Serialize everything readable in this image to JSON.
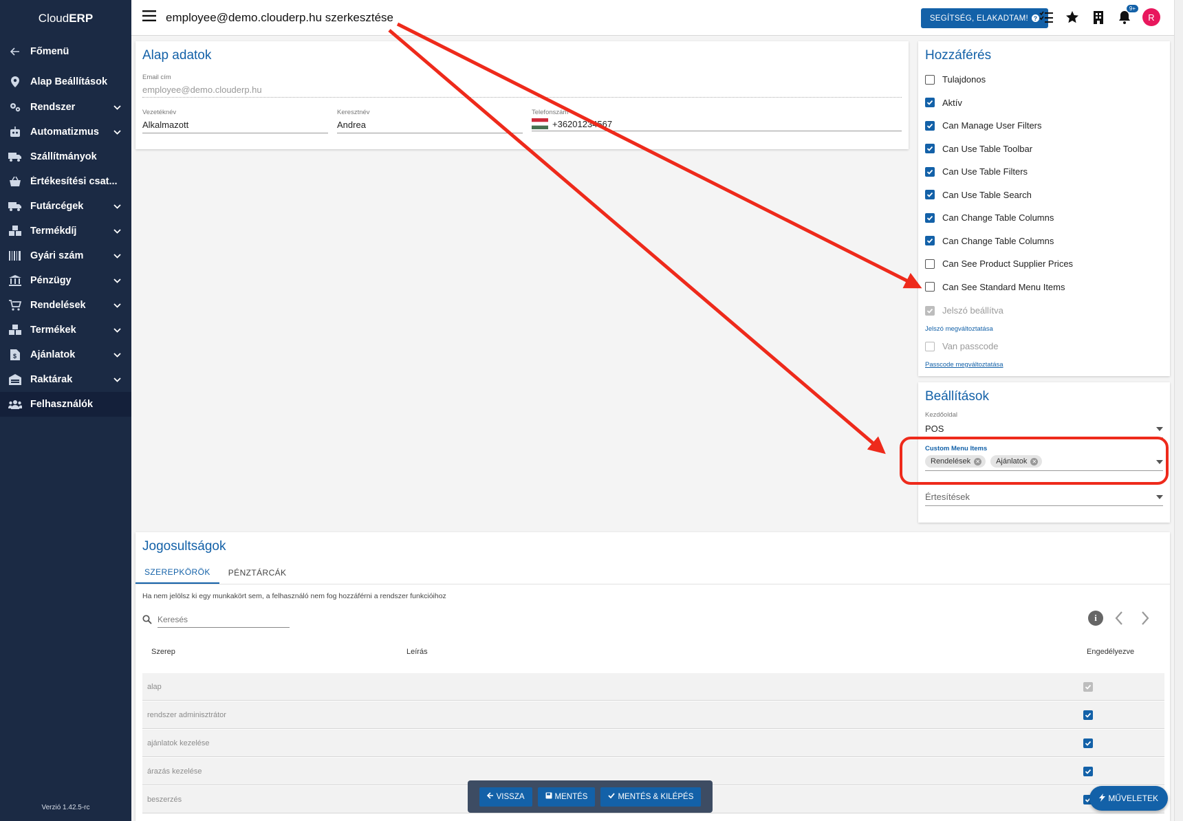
{
  "app": {
    "brand_light": "Cloud",
    "brand_bold": "ERP",
    "version": "Verzió 1.42.5-rc"
  },
  "sidebar": {
    "back_label": "Főmenü",
    "items": [
      {
        "label": "Alap Beállítások",
        "icon": "pin-icon",
        "chevron": false
      },
      {
        "label": "Rendszer",
        "icon": "cogs-icon",
        "chevron": true
      },
      {
        "label": "Automatizmus",
        "icon": "robot-icon",
        "chevron": true
      },
      {
        "label": "Szállítmányok",
        "icon": "truck-icon",
        "chevron": false
      },
      {
        "label": "Értékesítési csat...",
        "icon": "basket-icon",
        "chevron": false
      },
      {
        "label": "Futárcégek",
        "icon": "truck-icon",
        "chevron": true
      },
      {
        "label": "Termékdíj",
        "icon": "boxes-icon",
        "chevron": true
      },
      {
        "label": "Gyári szám",
        "icon": "barcode-icon",
        "chevron": true
      },
      {
        "label": "Pénzügy",
        "icon": "bank-icon",
        "chevron": true
      },
      {
        "label": "Rendelések",
        "icon": "cart-icon",
        "chevron": true
      },
      {
        "label": "Termékek",
        "icon": "boxes-icon",
        "chevron": true
      },
      {
        "label": "Ajánlatok",
        "icon": "file-dollar-icon",
        "chevron": true
      },
      {
        "label": "Raktárak",
        "icon": "warehouse-icon",
        "chevron": true
      },
      {
        "label": "Felhasználók",
        "icon": "users-icon",
        "chevron": false
      }
    ]
  },
  "header": {
    "title": "employee@demo.clouderp.hu szerkesztése",
    "help_label": "SEGÍTSÉG, ELAKADTAM!",
    "notif_badge": "9+",
    "avatar_letter": "R"
  },
  "basic": {
    "title": "Alap adatok",
    "email_label": "Email cím",
    "email_value": "employee@demo.clouderp.hu",
    "lastname_label": "Vezetéknév",
    "lastname_value": "Alkalmazott",
    "firstname_label": "Keresztnév",
    "firstname_value": "Andrea",
    "phone_label": "Telefonszám",
    "phone_value": "+36201234567"
  },
  "access": {
    "title": "Hozzáférés",
    "items": [
      {
        "label": "Tulajdonos",
        "checked": false
      },
      {
        "label": "Aktív",
        "checked": true
      },
      {
        "label": "Can Manage User Filters",
        "checked": true
      },
      {
        "label": "Can Use Table Toolbar",
        "checked": true
      },
      {
        "label": "Can Use Table Filters",
        "checked": true
      },
      {
        "label": "Can Use Table Search",
        "checked": true
      },
      {
        "label": "Can Change Table Columns",
        "checked": true
      },
      {
        "label": "Can Change Table Columns",
        "checked": true
      },
      {
        "label": "Can See Product Supplier Prices",
        "checked": false
      },
      {
        "label": "Can See Standard Menu Items",
        "checked": false
      }
    ],
    "password_set_label": "Jelszó beállítva",
    "password_change_link": "Jelszó megváltoztatása",
    "passcode_label": "Van passcode",
    "passcode_change_link": "Passcode megváltoztatása"
  },
  "settings": {
    "title": "Beállítások",
    "home_label": "Kezdőoldal",
    "home_value": "POS",
    "custom_menu_label": "Custom Menu Items",
    "custom_menu_chips": [
      "Rendelések",
      "Ajánlatok"
    ],
    "notifications_placeholder": "Értesítések"
  },
  "permissions": {
    "title": "Jogosultságok",
    "tabs": [
      "SZEREPKÖRÖK",
      "PÉNZTÁRCÁK"
    ],
    "info_text": "Ha nem jelölsz ki egy munkakört sem, a felhasználó nem fog hozzáférni a rendszer funkcióihoz",
    "search_placeholder": "Keresés",
    "columns": {
      "role": "Szerep",
      "description": "Leírás",
      "enabled": "Engedélyezve"
    },
    "rows": [
      {
        "role": "alap",
        "enabled": "disabled-checked"
      },
      {
        "role": "rendszer adminisztrátor",
        "enabled": "checked"
      },
      {
        "role": "ajánlatok kezelése",
        "enabled": "checked"
      },
      {
        "role": "árazás kezelése",
        "enabled": "checked"
      },
      {
        "role": "beszerzés",
        "enabled": "checked"
      }
    ]
  },
  "bottom": {
    "back_label": "VISSZA",
    "save_label": "MENTÉS",
    "save_exit_label": "MENTÉS & KILÉPÉS",
    "actions_label": "MŰVELETEK"
  },
  "colors": {
    "sidebar": "#1b2a44",
    "accent": "#1361a8",
    "annotation": "#ee2a1b",
    "avatar": "#e8175d"
  }
}
